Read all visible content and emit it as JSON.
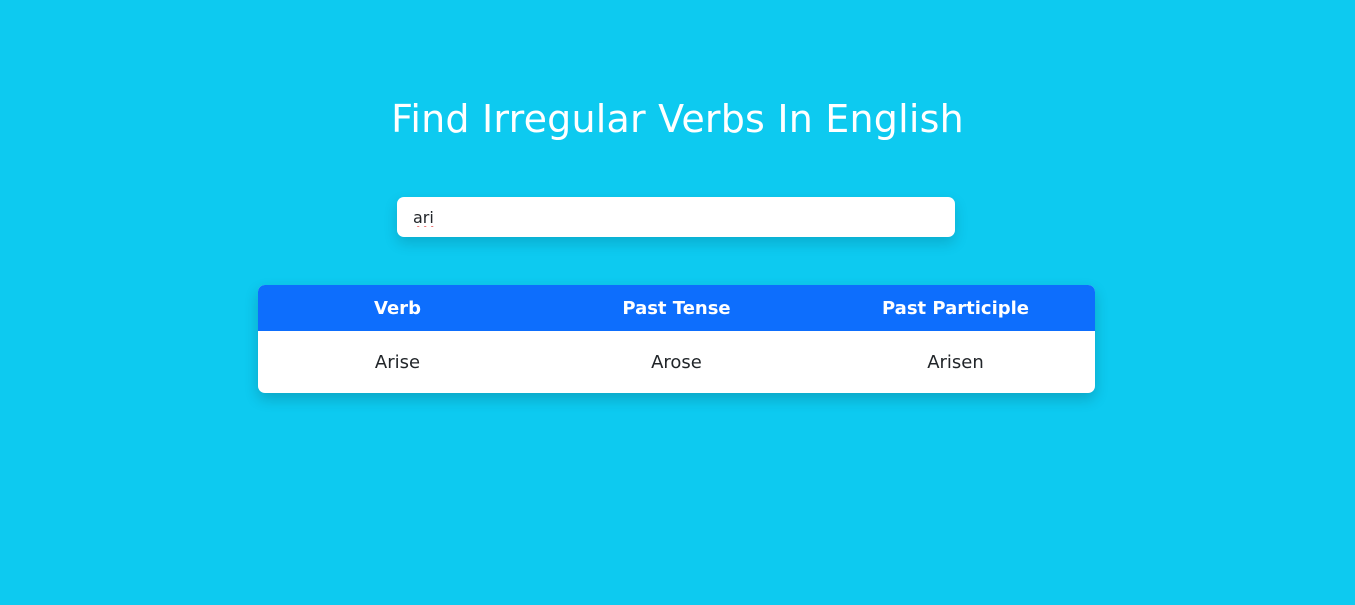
{
  "page": {
    "title": "Find Irregular Verbs In English",
    "background_color": "#0dcaf0"
  },
  "search": {
    "value": "ari",
    "placeholder": ""
  },
  "table": {
    "header_color": "#0d6efd",
    "columns": [
      "Verb",
      "Past Tense",
      "Past Participle"
    ],
    "rows": [
      [
        "Arise",
        "Arose",
        "Arisen"
      ]
    ]
  }
}
